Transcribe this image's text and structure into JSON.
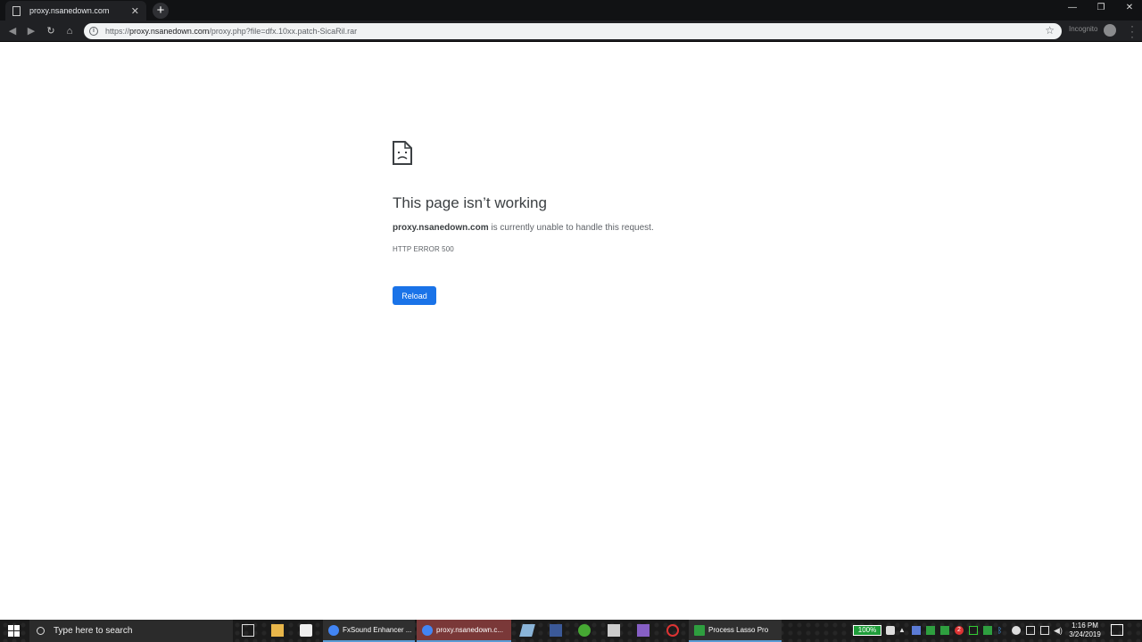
{
  "browser": {
    "tab_title": "proxy.nsanedown.com",
    "tab_close": "✕",
    "new_tab": "+",
    "url_host": "proxy.nsanedown.com",
    "url_scheme": "https://",
    "url_path": "/proxy.php?file=dfx.10xx.patch-SicaRil.rar",
    "incognito_label": "Incognito",
    "window_controls": [
      "—",
      "❐",
      "✕"
    ]
  },
  "error_page": {
    "title": "This page isn’t working",
    "host": "proxy.nsanedown.com",
    "message": " is currently unable to handle this request.",
    "code": "HTTP ERROR 500",
    "reload_label": "Reload"
  },
  "taskbar": {
    "search_placeholder": "Type here to search",
    "apps": [
      {
        "label": "FxSound Enhancer ...",
        "color": "#d04a2a"
      },
      {
        "label": "proxy.nsanedown.c...",
        "color": "#4285f4"
      },
      {
        "label": "Process Lasso Pro",
        "color": "#2e9e3f"
      }
    ],
    "battery": "100%",
    "time": "1:16 PM",
    "date": "3/24/2019",
    "notification_badge": "2"
  }
}
